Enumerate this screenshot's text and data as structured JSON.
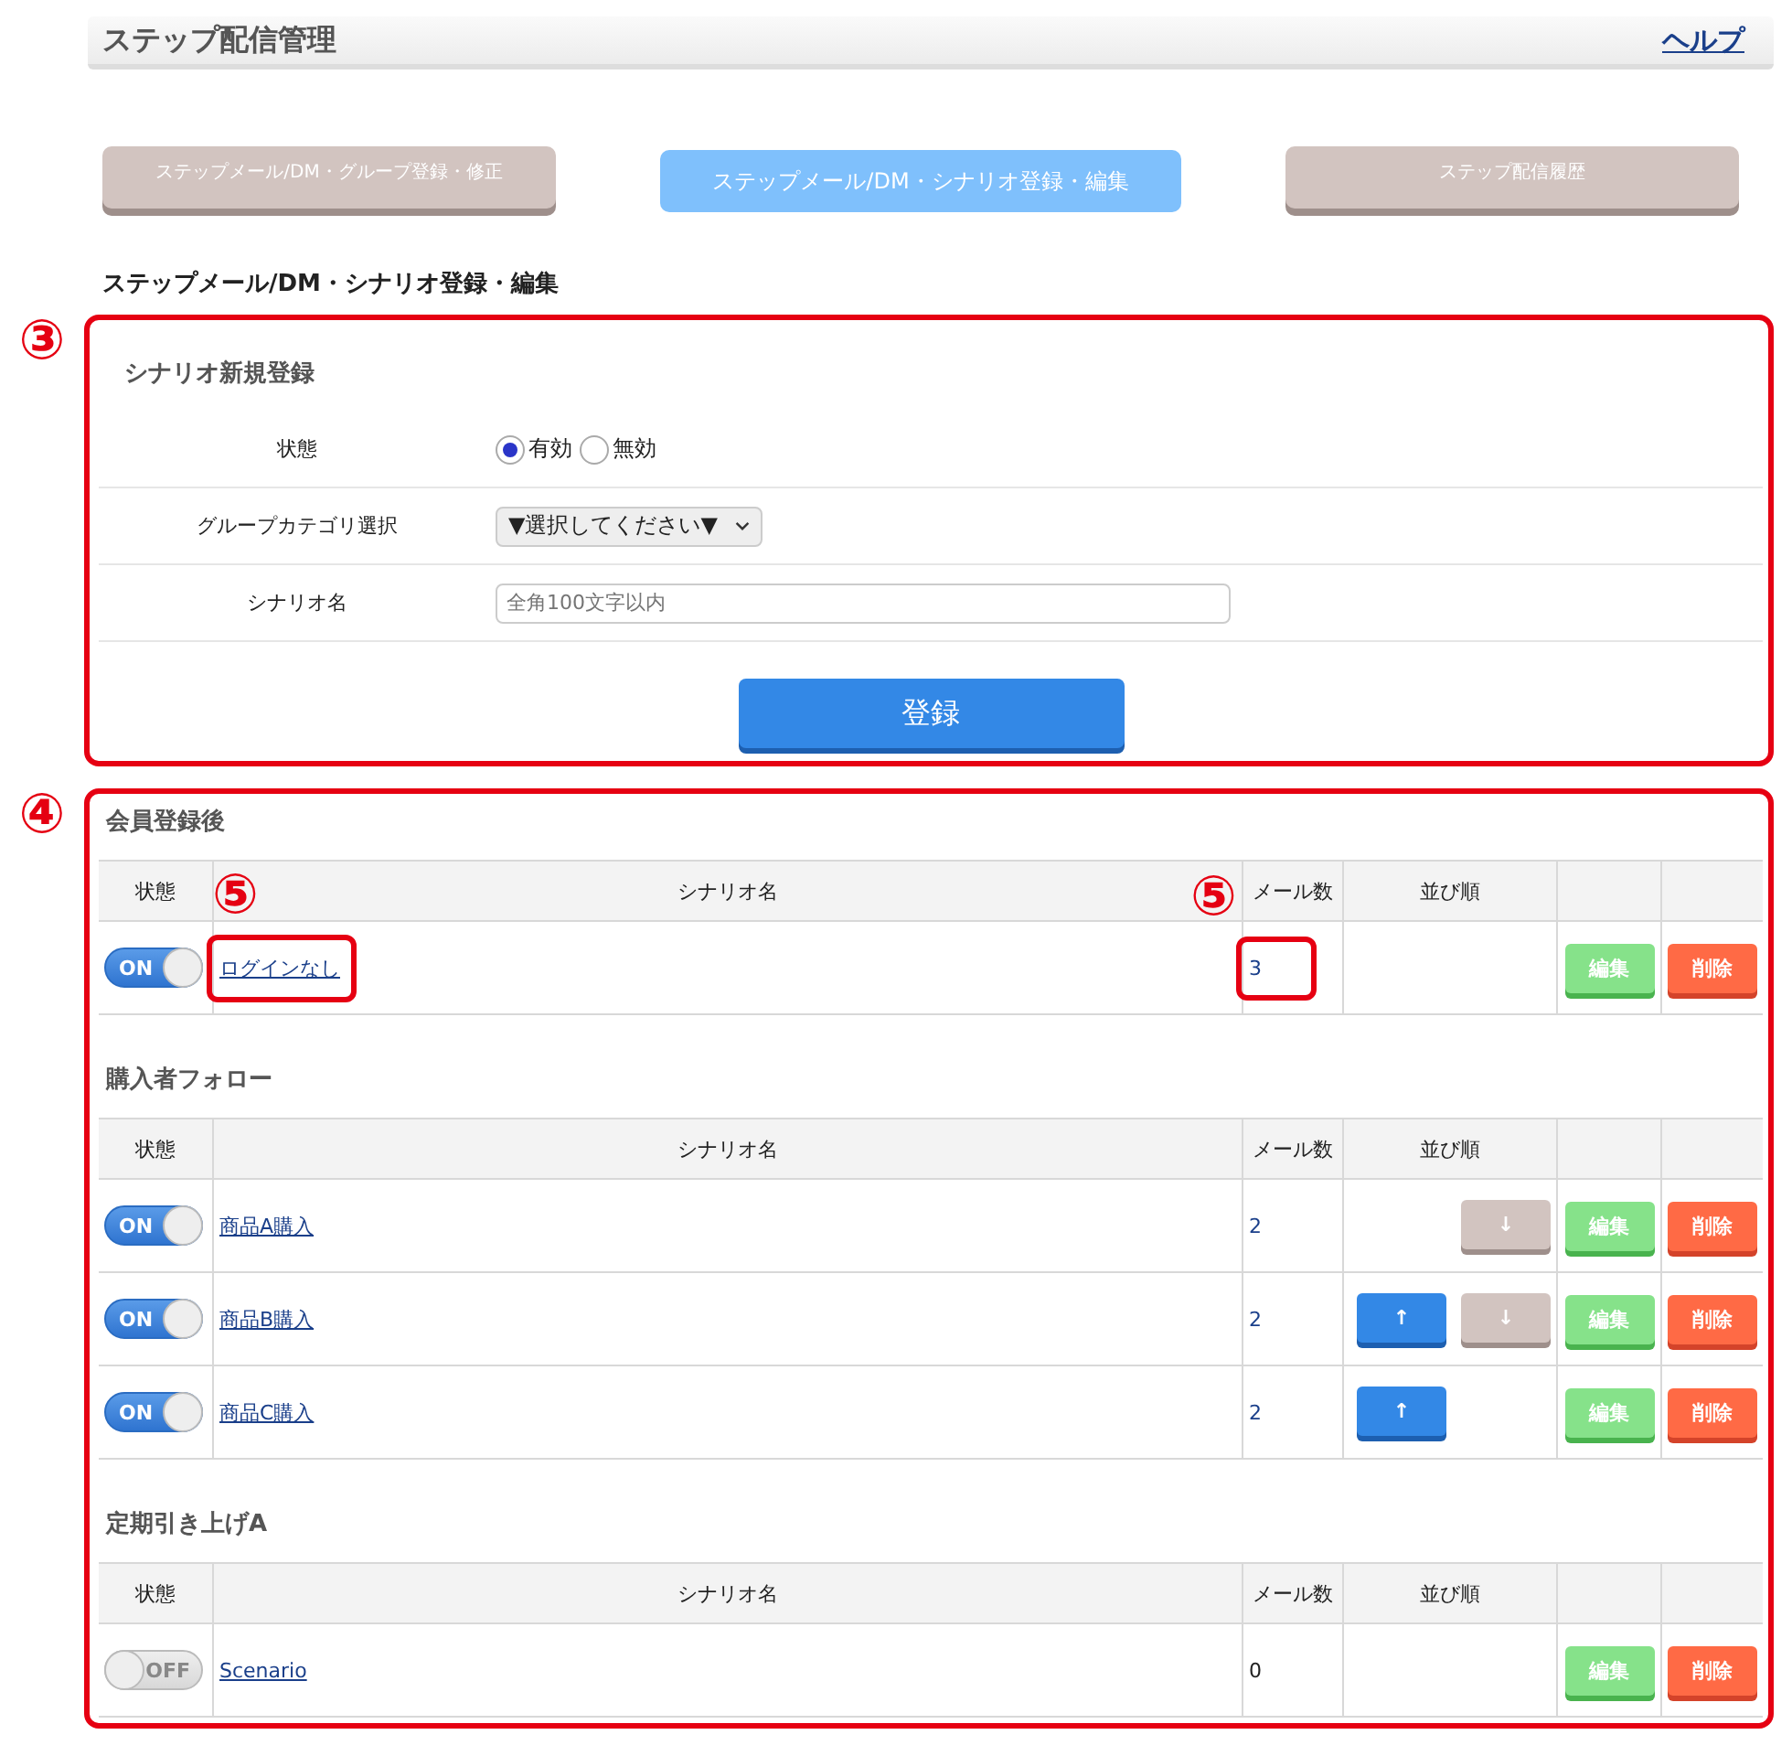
{
  "header": {
    "title": "ステップ配信管理",
    "help": "ヘルプ"
  },
  "tabs": [
    {
      "label": "ステップメール/DM・グループ登録・修正",
      "selected": false
    },
    {
      "label": "ステップメール/DM・シナリオ登録・編集",
      "selected": true
    },
    {
      "label": "ステップ配信履歴",
      "selected": false
    }
  ],
  "page_title": "ステップメール/DM・シナリオ登録・編集",
  "new_scenario": {
    "callout": "③",
    "title": "シナリオ新規登録",
    "status": {
      "label": "状態",
      "options": [
        {
          "label": "有効",
          "selected": true
        },
        {
          "label": "無効",
          "selected": false
        }
      ]
    },
    "category": {
      "label": "グループカテゴリ選択",
      "value": "▼選択してください▼"
    },
    "name": {
      "label": "シナリオ名",
      "placeholder": "全角100文字以内"
    },
    "submit": "登録"
  },
  "scenario_list": {
    "callout": "④",
    "groups": [
      {
        "title": "会員登録後",
        "columns": [
          "状態",
          "シナリオ名",
          "メール数",
          "並び順"
        ],
        "rows": [
          {
            "on": true,
            "toggle_label": "ON",
            "name": "ログインなし",
            "count": "3",
            "count_link": true,
            "order": [],
            "edit": "編集",
            "delete": "削除",
            "name_callout": "⑤",
            "count_callout": "⑤"
          }
        ]
      },
      {
        "title": "購入者フォロー",
        "columns": [
          "状態",
          "シナリオ名",
          "メール数",
          "並び順"
        ],
        "rows": [
          {
            "on": true,
            "toggle_label": "ON",
            "name": "商品A購入",
            "count": "2",
            "count_link": true,
            "order": [
              {
                "kind": "down",
                "label": "↓"
              }
            ],
            "edit": "編集",
            "delete": "削除"
          },
          {
            "on": true,
            "toggle_label": "ON",
            "name": "商品B購入",
            "count": "2",
            "count_link": true,
            "order": [
              {
                "kind": "up",
                "label": "↑"
              },
              {
                "kind": "down",
                "label": "↓"
              }
            ],
            "edit": "編集",
            "delete": "削除"
          },
          {
            "on": true,
            "toggle_label": "ON",
            "name": "商品C購入",
            "count": "2",
            "count_link": true,
            "order": [
              {
                "kind": "up",
                "label": "↑"
              }
            ],
            "edit": "編集",
            "delete": "削除"
          }
        ]
      },
      {
        "title": "定期引き上げA",
        "columns": [
          "状態",
          "シナリオ名",
          "メール数",
          "並び順"
        ],
        "rows": [
          {
            "on": false,
            "toggle_label": "OFF",
            "name": "Scenario",
            "count": "0",
            "count_link": false,
            "order": [],
            "edit": "編集",
            "delete": "削除"
          }
        ]
      }
    ]
  }
}
